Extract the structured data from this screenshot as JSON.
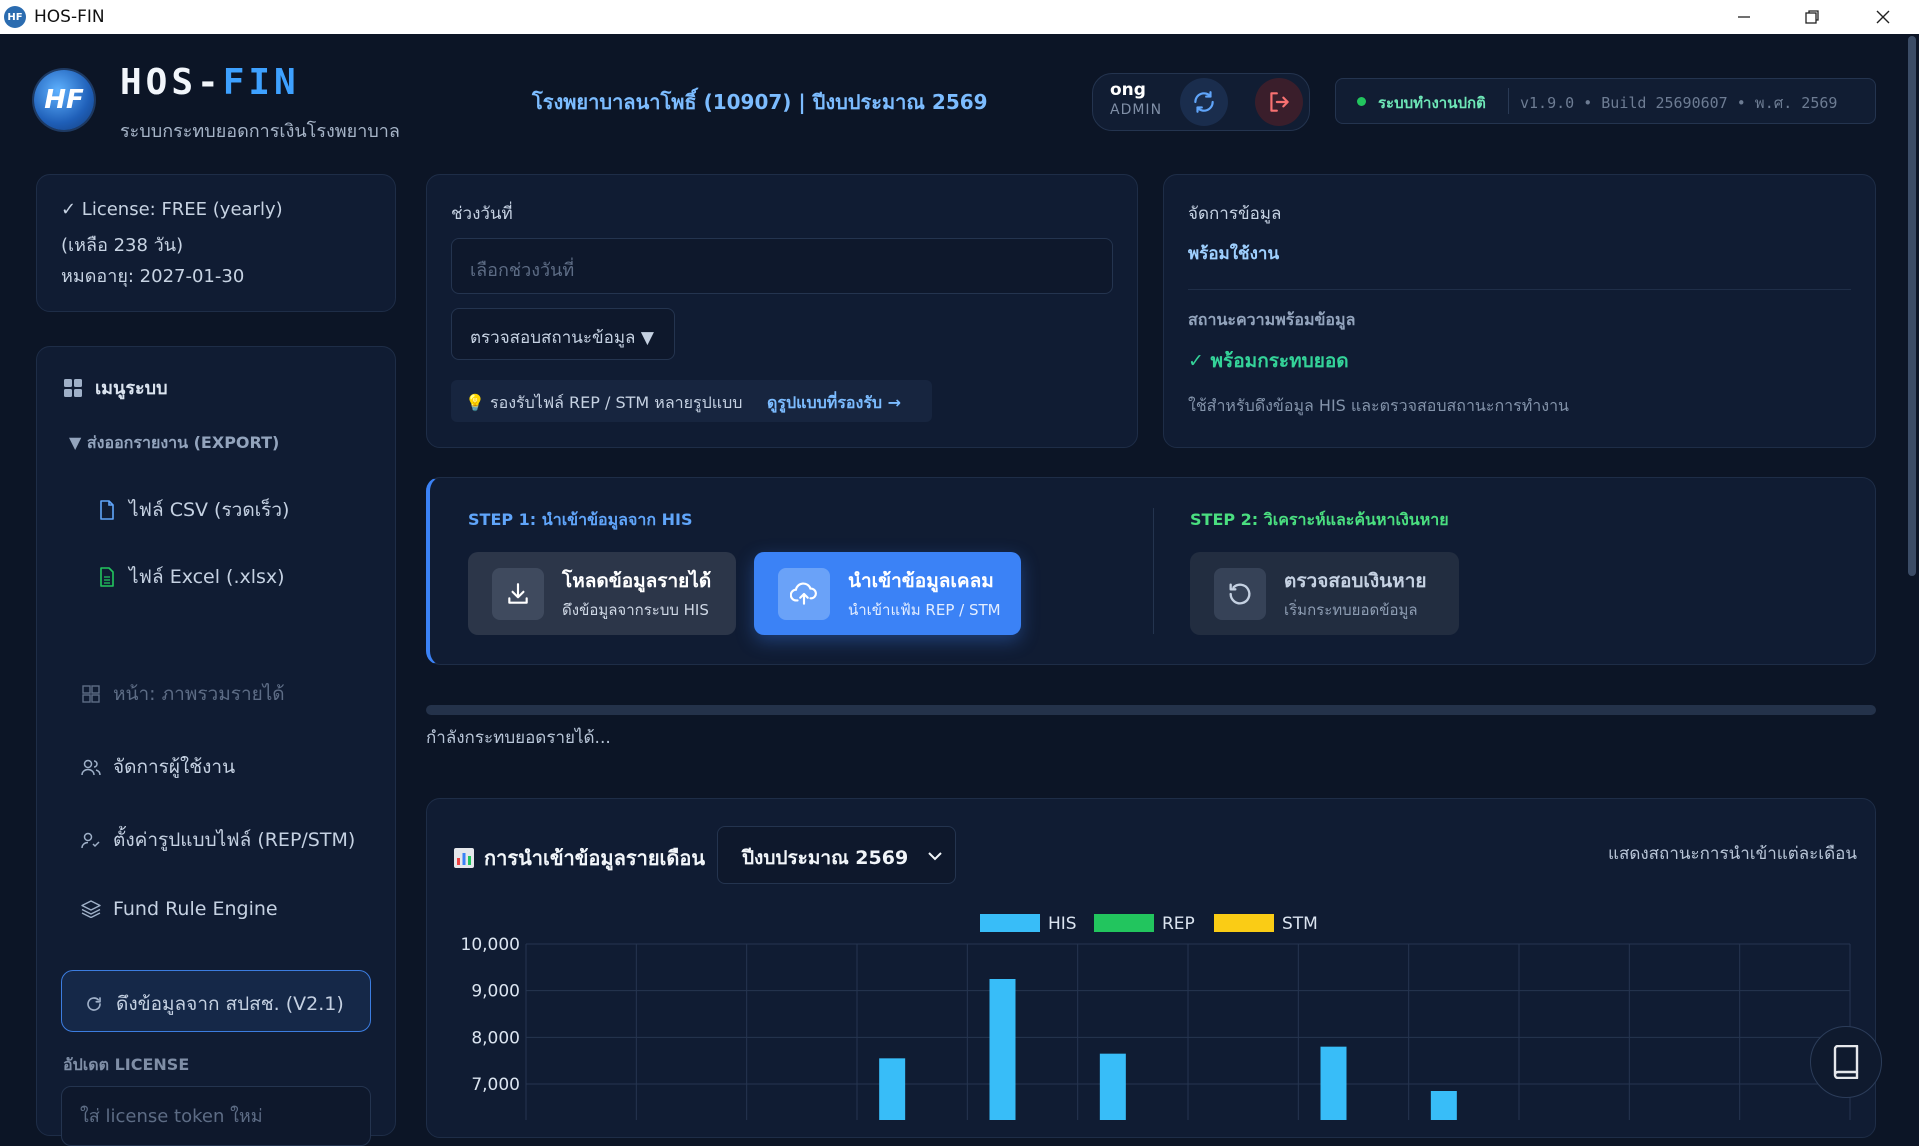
{
  "window": {
    "title": "HOS-FIN",
    "icon_text": "HF"
  },
  "header": {
    "brand_a": "HOS-",
    "brand_b": "FIN",
    "logo_text": "HF",
    "subtitle": "ระบบกระทบยอดการเงินโรงพยาบาล",
    "hospital": "โรงพยาบาลนาโพธิ์ (10907) | ปีงบประมาณ 2569",
    "user": {
      "name": "ong",
      "role": "ADMIN"
    },
    "status": "ระบบทำงานปกติ",
    "version": "v1.9.0 • Build 25690607 • พ.ศ. 2569"
  },
  "license": {
    "line1": "✓ License: FREE (yearly)",
    "line2": "(เหลือ 238 วัน)",
    "line3": "หมดอายุ: 2027-01-30"
  },
  "sidebar": {
    "title": "เมนูระบบ",
    "export_group": "▼ ส่งออกรายงาน (EXPORT)",
    "export_items": [
      {
        "label": "ไฟล์ CSV (รวดเร็ว)"
      },
      {
        "label": "ไฟล์ Excel (.xlsx)"
      }
    ],
    "items": [
      {
        "label": "หน้า: ภาพรวมรายได้"
      },
      {
        "label": "จัดการผู้ใช้งาน"
      },
      {
        "label": "ตั้งค่ารูปแบบไฟล์ (REP/STM)"
      },
      {
        "label": "Fund Rule Engine"
      }
    ],
    "fetch_button": "ดึงข้อมูลจาก สปสช. (V2.1)",
    "license_update_label": "อัปเดต LICENSE",
    "license_token_placeholder": "ใส่ license token ใหม่"
  },
  "date_panel": {
    "label": "ช่วงวันที่",
    "placeholder": "เลือกช่วงวันที่",
    "check_button": "ตรวจสอบสถานะข้อมูล ▼",
    "hint": "💡 รองรับไฟล์ REP / STM หลายรูปแบบ",
    "hint_link": "ดูรูปแบบที่รองรับ →"
  },
  "data_panel": {
    "label": "จัดการข้อมูล",
    "value": "พร้อมใช้งาน",
    "readiness_label": "สถานะความพร้อมข้อมูล",
    "readiness_value": "✓ พร้อมกระทบยอด",
    "note": "ใช้สำหรับดึงข้อมูล HIS และตรวจสอบสถานะการทำงาน"
  },
  "steps": {
    "step1_title": "STEP 1: นำเข้าข้อมูลจาก HIS",
    "step2_title": "STEP 2: วิเคราะห์และค้นหาเงินหาย",
    "btn_download": {
      "title": "โหลดข้อมูลรายได้",
      "sub": "ดึงข้อมูลจากระบบ HIS"
    },
    "btn_import": {
      "title": "นำเข้าข้อมูลเคลม",
      "sub": "นำเข้าแฟ้ม REP / STM"
    },
    "btn_check": {
      "title": "ตรวจสอบเงินหาย",
      "sub": "เริ่มกระทบยอดข้อมูล"
    }
  },
  "progress": {
    "text": "กำลังกระทบยอดรายได้...",
    "value": 0
  },
  "chart_panel": {
    "title": "การนำเข้าข้อมูลรายเดือน",
    "title_icon": "bar-chart-icon",
    "year_select": "ปีงบประมาณ 2569",
    "note": "แสดงสถานะการนำเข้าแต่ละเดือน"
  },
  "chart_data": {
    "type": "bar",
    "legend": [
      "HIS",
      "REP",
      "STM"
    ],
    "colors": {
      "HIS": "#38bdf8",
      "REP": "#22c55e",
      "STM": "#facc15"
    },
    "yticks": [
      "10,000",
      "9,000",
      "8,000",
      "7,000"
    ],
    "ylim_visible": [
      7000,
      10000
    ],
    "series": [
      {
        "name": "HIS",
        "values": [
          null,
          null,
          null,
          7550,
          9250,
          7650,
          null,
          7800,
          6850,
          null,
          null,
          null
        ]
      },
      {
        "name": "REP",
        "values": []
      },
      {
        "name": "STM",
        "values": []
      }
    ]
  },
  "colors": {
    "accent": "#3ea1ff",
    "primary_button": "#3b82f6",
    "success": "#22c55e",
    "danger": "#f87171"
  }
}
